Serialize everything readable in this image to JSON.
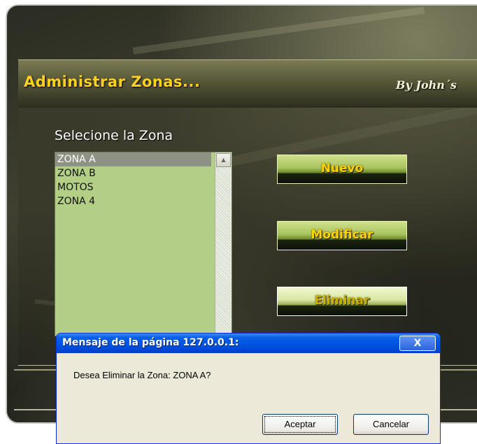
{
  "app": {
    "title": "Administrar Zonas...",
    "byline": "By John´s"
  },
  "zones": {
    "label": "Selecione la Zona",
    "items": [
      "ZONA A",
      "ZONA B",
      "MOTOS",
      "ZONA 4"
    ],
    "selected": "ZONA A"
  },
  "actions": {
    "nuevo": "Nuevo",
    "modificar": "Modificar",
    "eliminar": "Eliminar"
  },
  "dialog": {
    "title": "Mensaje de la página 127.0.0.1:",
    "close_glyph": "X",
    "message": "Desea Eliminar la Zona: ZONA A?",
    "ok_label": "Aceptar",
    "cancel_label": "Cancelar"
  },
  "colors": {
    "title_text": "#ffd21c",
    "list_background": "#b2cf85",
    "dialog_titlebar": "#0054e3"
  }
}
